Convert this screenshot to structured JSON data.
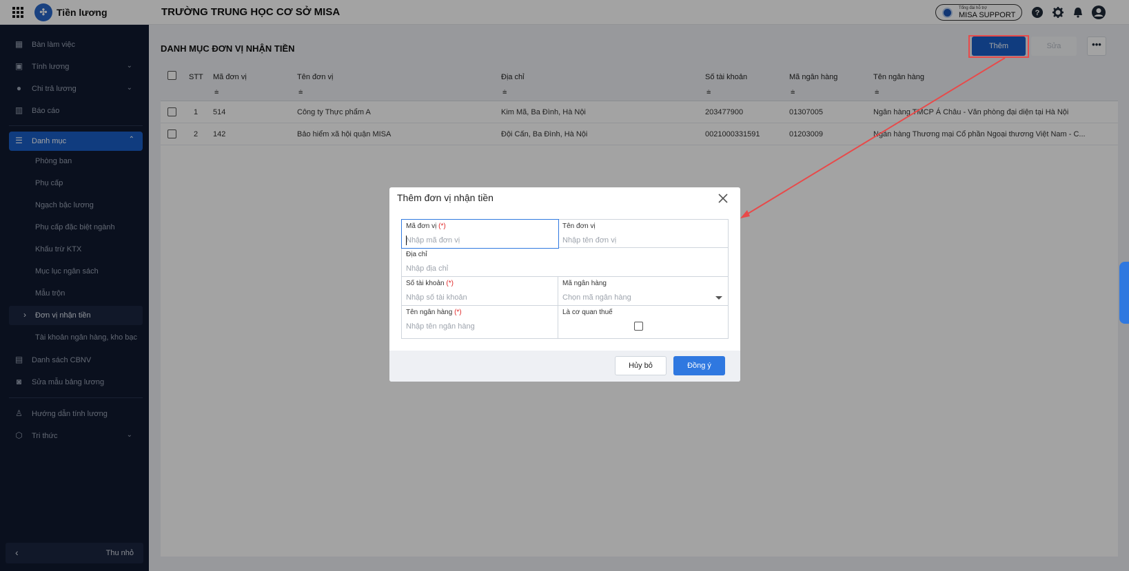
{
  "topbar": {
    "app_name": "Tiền lương",
    "school_name": "TRƯỜNG TRUNG HỌC CƠ SỞ MISA",
    "support_small": "Tổng đài hỗ trợ",
    "support_label": "MISA SUPPORT"
  },
  "sidebar": {
    "items": [
      {
        "label": "Bàn làm việc",
        "icon": "dashboard-icon"
      },
      {
        "label": "Tính lương",
        "icon": "calculator-icon"
      },
      {
        "label": "Chi trả lương",
        "icon": "payment-icon"
      },
      {
        "label": "Báo cáo",
        "icon": "report-icon"
      }
    ],
    "active": {
      "label": "Danh mục",
      "icon": "list-icon"
    },
    "sub_items": [
      "Phòng ban",
      "Phụ cấp",
      "Ngạch bậc lương",
      "Phụ cấp đặc biệt ngành",
      "Khấu trừ KTX",
      "Mục lục ngân sách",
      "Mẫu trộn",
      "Đơn vị nhận tiền",
      "Tài khoản ngân hàng, kho bạc"
    ],
    "after_items": [
      {
        "label": "Danh sách CBNV",
        "icon": "people-list-icon"
      },
      {
        "label": "Sửa mẫu bảng lương",
        "icon": "edit-template-icon"
      }
    ],
    "help_items": [
      {
        "label": "Hướng dẫn tính lương",
        "icon": "guide-icon"
      },
      {
        "label": "Tri thức",
        "icon": "knowledge-icon"
      }
    ],
    "collapse_label": "Thu nhỏ"
  },
  "page": {
    "title": "DANH MỤC ĐƠN VỊ NHẬN TIỀN",
    "add_label": "Thêm",
    "edit_label": "Sửa",
    "more_label": "•••"
  },
  "grid": {
    "columns": [
      "STT",
      "Mã đơn vị",
      "Tên đơn vị",
      "Địa chỉ",
      "Số tài khoản",
      "Mã ngân hàng",
      "Tên ngân hàng"
    ],
    "filter_icon": "filter-icon",
    "rows": [
      {
        "stt": "1",
        "code": "514",
        "name": "Công ty Thực phẩm A",
        "address": "Kim Mã, Ba Đình, Hà Nội",
        "account": "203477900",
        "bank_code": "01307005",
        "bank_name": "Ngân hàng TMCP Á Châu - Văn phòng đại diện tại Hà Nội"
      },
      {
        "stt": "2",
        "code": "142",
        "name": "Bảo hiểm xã hội quận MISA",
        "address": "Đội Cấn, Ba Đình, Hà Nội",
        "account": "0021000331591",
        "bank_code": "01203009",
        "bank_name": "Ngân hàng Thương mại Cổ phần Ngoại thương Việt Nam - C..."
      }
    ]
  },
  "modal": {
    "title": "Thêm đơn vị nhận tiền",
    "fields": {
      "code": {
        "label": "Mã đơn vị",
        "required": "(*)",
        "placeholder": "Nhập mã đơn vị"
      },
      "name": {
        "label": "Tên đơn vị",
        "placeholder": "Nhập tên đơn vị"
      },
      "address": {
        "label": "Địa chỉ",
        "placeholder": "Nhập địa chỉ"
      },
      "account": {
        "label": "Số tài khoản",
        "required": "(*)",
        "placeholder": "Nhập số tài khoản"
      },
      "bank_code": {
        "label": "Mã ngân hàng",
        "placeholder": "Chọn mã ngân hàng"
      },
      "bank_name": {
        "label": "Tên ngân hàng",
        "required": "(*)",
        "placeholder": "Nhập tên ngân hàng"
      },
      "tax": {
        "label": "Là cơ quan thuế",
        "checked": false
      }
    },
    "cancel_label": "Hủy bỏ",
    "ok_label": "Đồng ý"
  },
  "colors": {
    "primary": "#1a5fc7",
    "sidebar_bg": "#101a30",
    "annotation": "#e84a4a"
  }
}
